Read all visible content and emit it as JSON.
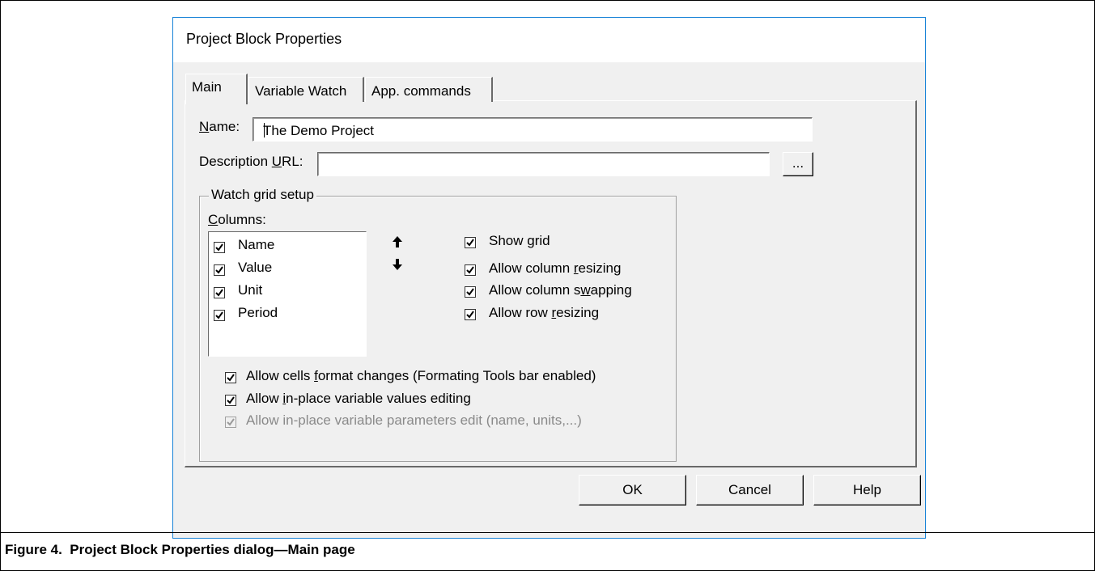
{
  "dialog": {
    "title": "Project Block Properties",
    "tabs": [
      {
        "label": "Main",
        "selected": true
      },
      {
        "label": "Variable Watch",
        "selected": false
      },
      {
        "label": "App. commands",
        "selected": false
      }
    ],
    "name_label": "Name:",
    "name_value": "The Demo Project",
    "desc_label": "Description URL:",
    "desc_value": "",
    "browse_label": "...",
    "group_title": "Watch grid setup",
    "columns_label": "Columns:",
    "columns": [
      {
        "label": "Name",
        "checked": true
      },
      {
        "label": "Value",
        "checked": true
      },
      {
        "label": "Unit",
        "checked": true
      },
      {
        "label": "Period",
        "checked": true
      }
    ],
    "grid_options": [
      {
        "label": "Show grid",
        "checked": true
      },
      {
        "label": "Allow column resizing",
        "checked": true
      },
      {
        "label": "Allow column swapping",
        "checked": true
      },
      {
        "label": "Allow row resizing",
        "checked": true
      }
    ],
    "edit_options": [
      {
        "label": "Allow cells format changes (Formating Tools bar enabled)",
        "checked": true,
        "enabled": true
      },
      {
        "label": "Allow in-place variable values editing",
        "checked": true,
        "enabled": true
      },
      {
        "label": "Allow in-place variable parameters edit (name, units,...)",
        "checked": true,
        "enabled": false
      }
    ],
    "buttons": {
      "ok": "OK",
      "cancel": "Cancel",
      "help": "Help"
    },
    "icons": {
      "move_up": "arrow-up-icon",
      "move_down": "arrow-down-icon"
    },
    "colors": {
      "border": "#1883d7",
      "face": "#f0f0f0"
    }
  },
  "caption": "Figure 4.  Project Block Properties dialog—Main page"
}
